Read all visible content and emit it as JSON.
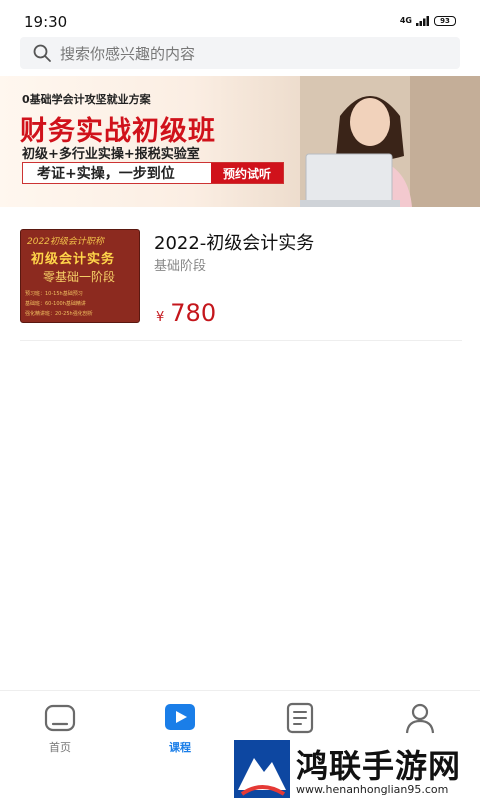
{
  "status_bar": {
    "time": "19:30",
    "network": "4G",
    "battery": "93"
  },
  "search": {
    "placeholder": "搜索你感兴趣的内容"
  },
  "banner": {
    "subtitle": "0基础学会计攻坚就业方案",
    "title": "财务实战初级班",
    "features": "初级+多行业实操+报税实验室",
    "slogan": "考证+实操，一步到位",
    "cta": "预约试听"
  },
  "course": {
    "thumbnail": {
      "line1": "2022初级会计职称",
      "line2": "初级会计实务",
      "line3": "零基础一阶段",
      "line4": "预习班：10-15h基础预习",
      "line5": "基础班：60-100h基础精讲",
      "line6": "强化精讲班：20-25h强化剖析"
    },
    "title": "2022-初级会计实务",
    "stage": "基础阶段",
    "currency": "¥",
    "price": "780"
  },
  "nav": {
    "items": [
      {
        "label": "首页",
        "icon": "home-icon"
      },
      {
        "label": "课程",
        "icon": "play-icon"
      },
      {
        "label": "",
        "icon": "list-icon"
      },
      {
        "label": "",
        "icon": "user-icon"
      }
    ],
    "active_color": "#1a7ee8"
  },
  "watermark": {
    "title": "鸿联手游网",
    "url": "www.henanhonglian95.com"
  },
  "colors": {
    "price": "#c4161c",
    "banner_red": "#d0121b",
    "accent": "#1a7ee8"
  }
}
